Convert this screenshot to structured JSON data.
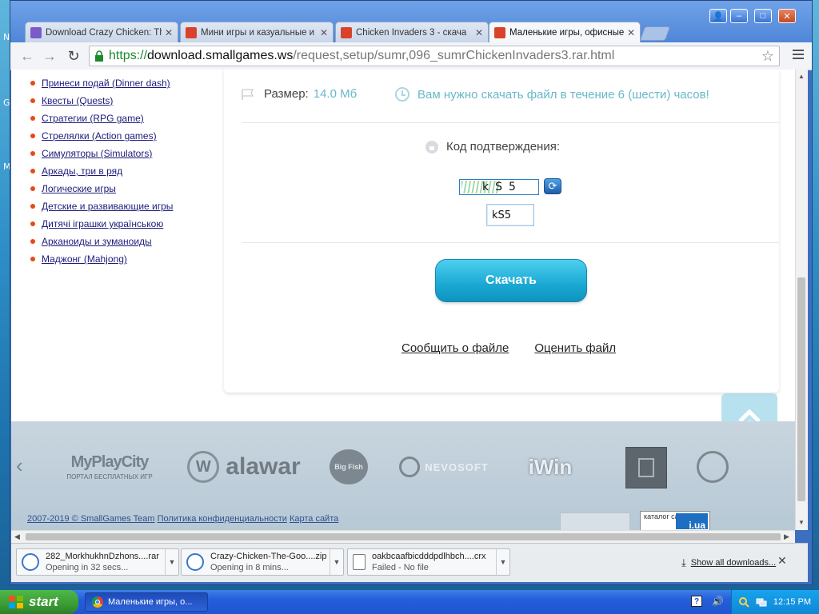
{
  "browser": {
    "tabs": [
      {
        "label": "Download Crazy Chicken: Th",
        "active": false,
        "favicon_color": "#7b5bc9"
      },
      {
        "label": "Мини игры и казуальные и",
        "active": false,
        "favicon_color": "#d9412a"
      },
      {
        "label": "Chicken Invaders 3 - скача",
        "active": false,
        "favicon_color": "#d9412a"
      },
      {
        "label": "Маленькие игры, офисные",
        "active": true,
        "favicon_color": "#d9412a"
      }
    ],
    "window_controls": {
      "user": "👤",
      "minimize": "–",
      "maximize": "□",
      "close": "✕"
    },
    "url": {
      "scheme": "https://",
      "host": "download.smallgames.ws",
      "path": "/request,setup/sumr,096_sumrChickenInvaders3.rar.html"
    }
  },
  "left_nav": [
    "Принеси подай (Dinner dash)",
    "Квесты (Quests)",
    "Стратегии (RPG game)",
    "Стрелялки (Action games)",
    "Симуляторы (Simulators)",
    "Аркады, три в ряд",
    "Логические игры",
    "Детские и развивающие игры",
    "Дитячі іграшки українською",
    "Арканоиды и зуманоиды",
    "Маджонг (Mahjong)"
  ],
  "download_card": {
    "size_label": "Размер:",
    "size_value": "14.0 Мб",
    "timer_text": "Вам нужно скачать файл в течение 6 (шести) часов!",
    "confirm_label": "Код подтверждения:",
    "captcha_chars": [
      "k",
      "S",
      "5"
    ],
    "captcha_input_value": "kS5",
    "download_button": "Скачать",
    "report_link": "Сообщить о файле",
    "rate_link": "Оценить файл"
  },
  "footer": {
    "partners": [
      {
        "name": "MyPlayCity",
        "caption": "ПОРТАЛ БЕСПЛАТНЫХ ИГР"
      },
      {
        "name": "alawar"
      },
      {
        "name": "Big Fish"
      },
      {
        "name": "NEVOSOFT"
      },
      {
        "name": "iWin"
      },
      {
        "name": ""
      },
      {
        "name": ""
      }
    ],
    "copyright": "2007-2019 © SmallGames Team",
    "privacy_link": "Политика конфиденциальности",
    "sitemap_link": "Карта сайта",
    "catalog_badge": "каталог сайтов",
    "catalog_badge_mark": "i.ua"
  },
  "downloads": [
    {
      "file": "282_MorkhukhnDzhons....rar",
      "status": "Opening in 32 secs..."
    },
    {
      "file": "Crazy-Chicken-The-Goo....zip",
      "status": "Opening in 8 mins..."
    },
    {
      "file": "oakbcaafbicdddpdlhbch....crx",
      "status": "Failed - No file"
    }
  ],
  "downloads_show_all": "Show all downloads...",
  "taskbar": {
    "start_label": "start",
    "task_label": "Маленькие игры, о...",
    "clock": "12:15 PM"
  },
  "desktop_letters": [
    "N",
    "G",
    "M"
  ]
}
